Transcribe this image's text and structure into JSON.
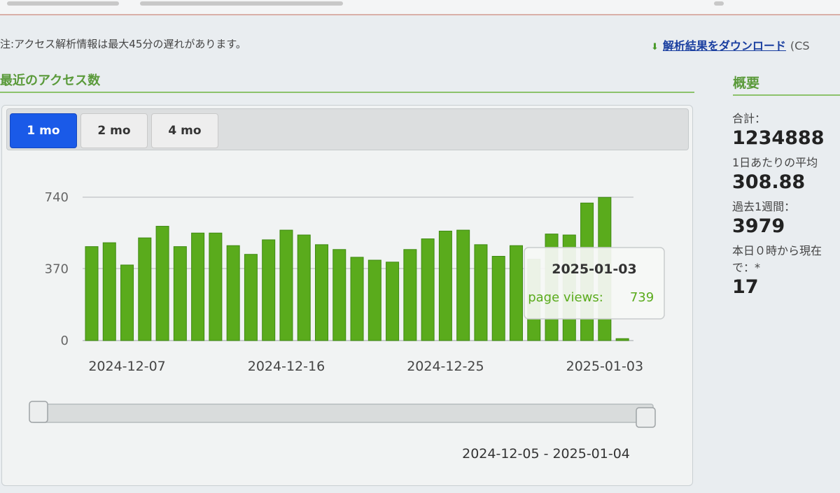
{
  "header": {
    "note": "注:アクセス解析情報は最大45分の遅れがあります。",
    "download_label": "解析結果をダウンロード",
    "download_suffix": "(CS"
  },
  "chart_section": {
    "title": "最近のアクセス数",
    "tabs": [
      {
        "label": "1 mo",
        "active": true
      },
      {
        "label": "2 mo",
        "active": false
      },
      {
        "label": "4 mo",
        "active": false
      }
    ],
    "range_label": "2024-12-05 - 2025-01-04"
  },
  "tooltip": {
    "date": "2025-01-03",
    "series_label": "page views:",
    "value": "739"
  },
  "summary": {
    "title": "概要",
    "items": [
      {
        "label": "合計：",
        "value": "1234888"
      },
      {
        "label": "1日あたりの平均",
        "value": "308.88"
      },
      {
        "label": "過去1週間：",
        "value": "3979"
      },
      {
        "label": "本日０時から現在",
        "label2": "で：*",
        "value": "17"
      }
    ]
  },
  "colors": {
    "bar": "#5aab1c",
    "bar_dark": "#3f8a12",
    "accent_blue": "#1a5ae8",
    "section_green": "#5a9a3a"
  },
  "chart_data": {
    "type": "bar",
    "title": "",
    "xlabel": "",
    "ylabel": "",
    "series": [
      {
        "name": "page views",
        "values": [
          485,
          505,
          390,
          530,
          590,
          485,
          555,
          555,
          490,
          445,
          520,
          570,
          545,
          495,
          470,
          430,
          415,
          405,
          470,
          525,
          565,
          570,
          495,
          435,
          490,
          420,
          550,
          545,
          710,
          739,
          10
        ]
      }
    ],
    "x": [
      "2024-12-05",
      "2024-12-06",
      "2024-12-07",
      "2024-12-08",
      "2024-12-09",
      "2024-12-10",
      "2024-12-11",
      "2024-12-12",
      "2024-12-13",
      "2024-12-14",
      "2024-12-15",
      "2024-12-16",
      "2024-12-17",
      "2024-12-18",
      "2024-12-19",
      "2024-12-20",
      "2024-12-21",
      "2024-12-22",
      "2024-12-23",
      "2024-12-24",
      "2024-12-25",
      "2024-12-26",
      "2024-12-27",
      "2024-12-28",
      "2024-12-29",
      "2024-12-30",
      "2024-12-31",
      "2025-01-01",
      "2025-01-02",
      "2025-01-03",
      "2025-01-04"
    ],
    "xtick_labels": [
      "2024-12-07",
      "2024-12-16",
      "2024-12-25",
      "2025-01-03"
    ],
    "ytick_labels": [
      "0",
      "370",
      "740"
    ],
    "ylim": [
      0,
      740
    ],
    "grid": true,
    "legend": "none"
  }
}
